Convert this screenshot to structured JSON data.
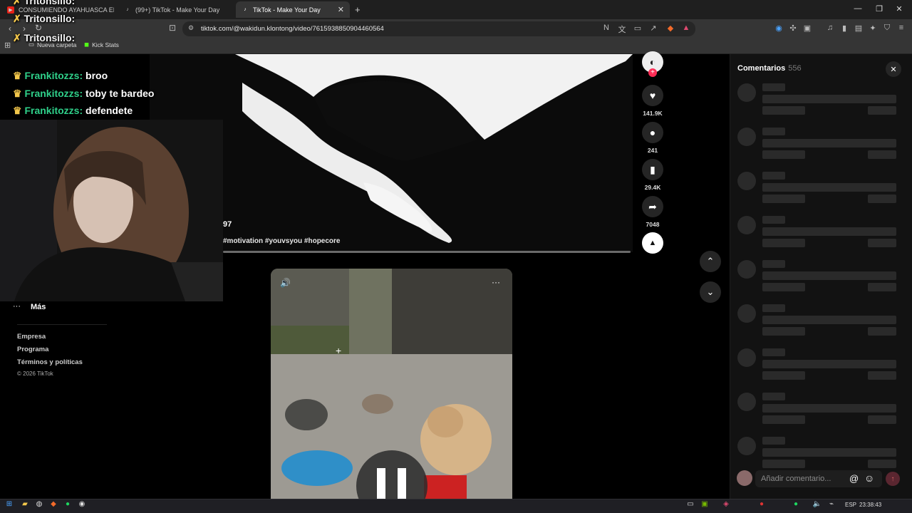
{
  "browser": {
    "tabs": [
      {
        "label": "CONSUMIENDO AYAHUASCA EN EL...",
        "icon": "youtube-icon"
      },
      {
        "label": "(99+) TikTok - Make Your Day",
        "icon": "tiktok-icon"
      },
      {
        "label": "TikTok - Make Your Day",
        "icon": "tiktok-icon",
        "active": true
      }
    ],
    "url": "tiktok.com/@wakidun.klontong/video/7615938850904460564",
    "bookmarks": [
      "Nueva carpeta",
      "Kick Stats"
    ]
  },
  "video": {
    "caption_number": "97",
    "caption_tags": "#motivation #youvsyou #hopecore",
    "actions": {
      "likes": "141.9K",
      "comments": "241",
      "saves": "29.4K",
      "shares": "7048"
    }
  },
  "sidebar": {
    "more": "Más",
    "links": [
      "Empresa",
      "Programa",
      "Términos y políticas"
    ],
    "copyright": "© 2026 TikTok"
  },
  "comments_panel": {
    "title": "Comentarios",
    "count": "556",
    "input_placeholder": "Añadir comentario..."
  },
  "chat": [
    {
      "user": "Tritonsillo:",
      "message": ""
    },
    {
      "user": "Tritonsillo:",
      "message": ""
    },
    {
      "user": "Tritonsillo:",
      "message": ""
    },
    {
      "user": "Frankitozzs:",
      "message": "broo"
    },
    {
      "user": "Frankitozzs:",
      "message": "toby te bardeo"
    },
    {
      "user": "Frankitozzs:",
      "message": "defendete"
    }
  ],
  "taskbar": {
    "language": "ESP",
    "time": "23:38:43"
  },
  "colors": {
    "tiktok_red": "#fe2c55",
    "chat_user": "#2fd08a",
    "panel_bg": "#121212"
  }
}
